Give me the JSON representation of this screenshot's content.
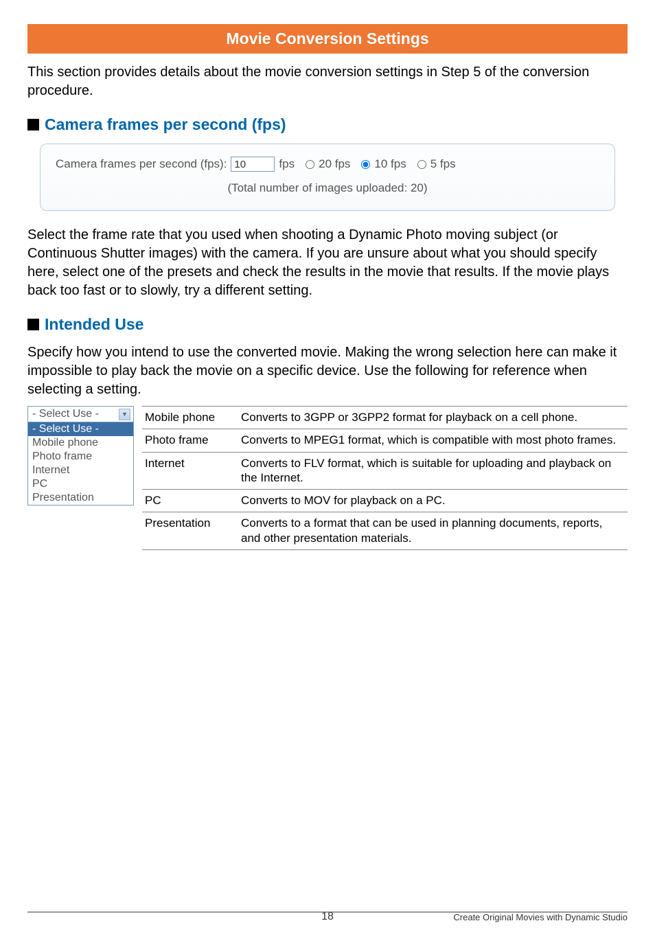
{
  "title": "Movie Conversion Settings",
  "intro": "This section provides details about the movie conversion settings in Step 5 of the conversion procedure.",
  "section1": {
    "heading": "Camera frames per second (fps)",
    "panel": {
      "label": "Camera frames per second (fps):",
      "input_value": "10",
      "fps_suffix": "fps",
      "opt20": "20 fps",
      "opt10": "10 fps",
      "opt5": "5 fps",
      "total_line": "(Total number of images uploaded: 20)"
    },
    "body": "Select the frame rate that you used when shooting a Dynamic Photo moving subject (or Continuous Shutter images) with the camera. If you are unsure about what you should specify here, select one of the presets and check the results in the movie that results. If the movie plays back too fast or to slowly, try a different setting."
  },
  "section2": {
    "heading": "Intended Use",
    "body": "Specify how you intend to use the converted movie. Making the wrong selection here can make it impossible to play back the movie on a specific device. Use the following for reference when selecting a setting.",
    "dropdown": {
      "top": "- Select Use -",
      "items": [
        "- Select Use -",
        "Mobile phone",
        "Photo frame",
        "Internet",
        "PC",
        "Presentation"
      ]
    },
    "table": [
      {
        "k": "Mobile phone",
        "v": "Converts to 3GPP or 3GPP2 format for playback on a cell phone."
      },
      {
        "k": "Photo frame",
        "v": "Converts to MPEG1 format, which is compatible with most photo frames."
      },
      {
        "k": "Internet",
        "v": "Converts to FLV format, which is suitable for uploading and playback on the Internet."
      },
      {
        "k": "PC",
        "v": "Converts to MOV for playback on a PC."
      },
      {
        "k": "Presentation",
        "v": "Converts to a format that can be used in planning documents, reports, and other presentation materials."
      }
    ]
  },
  "footer": {
    "page": "18",
    "right": "Create Original Movies with Dynamic Studio"
  }
}
